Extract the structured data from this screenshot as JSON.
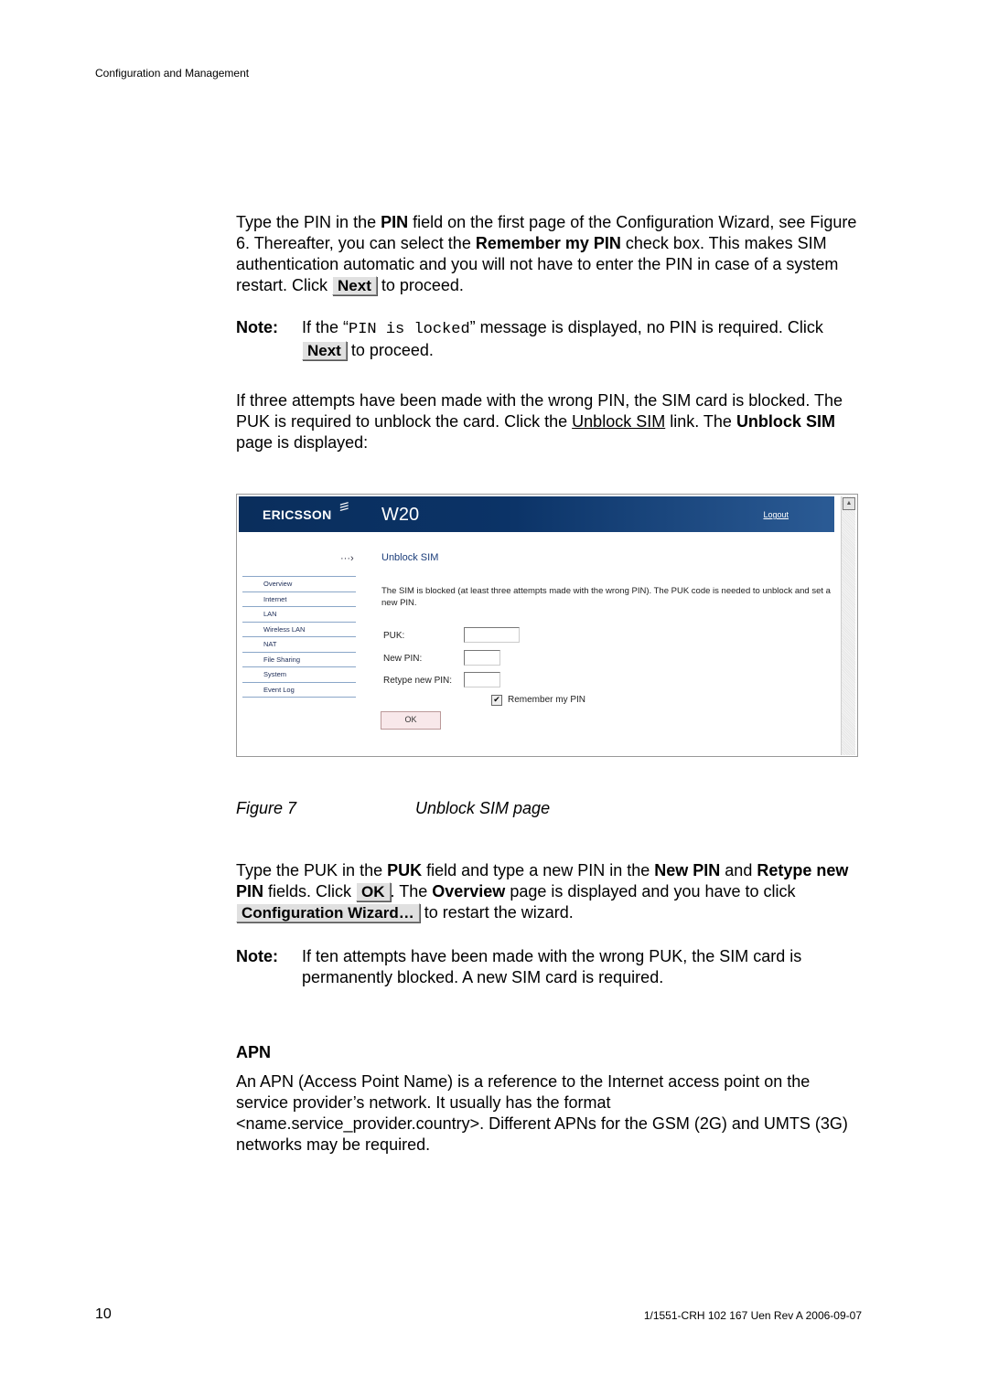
{
  "page_header": "Configuration and Management",
  "para1": {
    "t1": "Type the PIN in the ",
    "b1": "PIN",
    "t2": " field on the first page of the Configuration Wizard, see Figure 6. Thereafter, you can select the ",
    "b2": "Remember my PIN",
    "t3": " check box. This makes SIM authentication automatic and you will not have to enter the PIN in case of a system restart. Click ",
    "btn": "Next",
    "t4": " to proceed."
  },
  "note1": {
    "label": "Note:",
    "t1": "If the “",
    "code": "PIN is locked",
    "t2": "” message is displayed, no PIN is required. Click ",
    "btn": "Next",
    "t3": " to proceed."
  },
  "para2": {
    "t1": "If three attempts have been made with the wrong PIN, the SIM card is blocked. The PUK is required to unblock the card. Click the ",
    "link": "Unblock SIM",
    "t2": " link. The ",
    "b1": "Unblock SIM",
    "t3": " page is displayed:"
  },
  "screenshot": {
    "brand": "ERICSSON",
    "product": "W20",
    "logout": "Logout",
    "nav": [
      "Overview",
      "Internet",
      "LAN",
      "Wireless LAN",
      "NAT",
      "File Sharing",
      "System",
      "Event Log"
    ],
    "title": "Unblock SIM",
    "description": "The SIM is blocked (at least three attempts made with the wrong PIN). The PUK code is needed to unblock and set a new PIN.",
    "puk_label": "PUK:",
    "new_pin_label": "New PIN:",
    "retype_label": "Retype new PIN:",
    "puk_value": "",
    "new_pin_value": "",
    "retype_value": "",
    "remember_label": "Remember my PIN",
    "remember_checked": true,
    "ok_label": "OK"
  },
  "figure": {
    "number": "Figure 7",
    "title": "Unblock SIM page"
  },
  "para3": {
    "t1": "Type the PUK in the ",
    "b1": "PUK",
    "t2": " field and type a new PIN in the ",
    "b2": "New PIN",
    "t3": " and ",
    "b3": "Retype new PIN",
    "t4": " fields. Click ",
    "btn1": "OK",
    "t5": ". The ",
    "b4": "Overview",
    "t6": " page is displayed and you have to click ",
    "btn2": "Configuration Wizard…",
    "t7": " to restart the wizard."
  },
  "note2": {
    "label": "Note:",
    "text": "If ten attempts have been made with the wrong PUK, the SIM card is permanently blocked. A new SIM card is required."
  },
  "apn": {
    "heading": "APN",
    "text": "An APN (Access Point Name) is a reference to the Internet access point on the service provider’s network. It usually has the format <name.service_provider.country>. Different APNs for the GSM (2G) and UMTS (3G) networks may be required."
  },
  "footer": {
    "page": "10",
    "doc": "1/1551-CRH 102 167 Uen Rev A  2006-09-07"
  }
}
